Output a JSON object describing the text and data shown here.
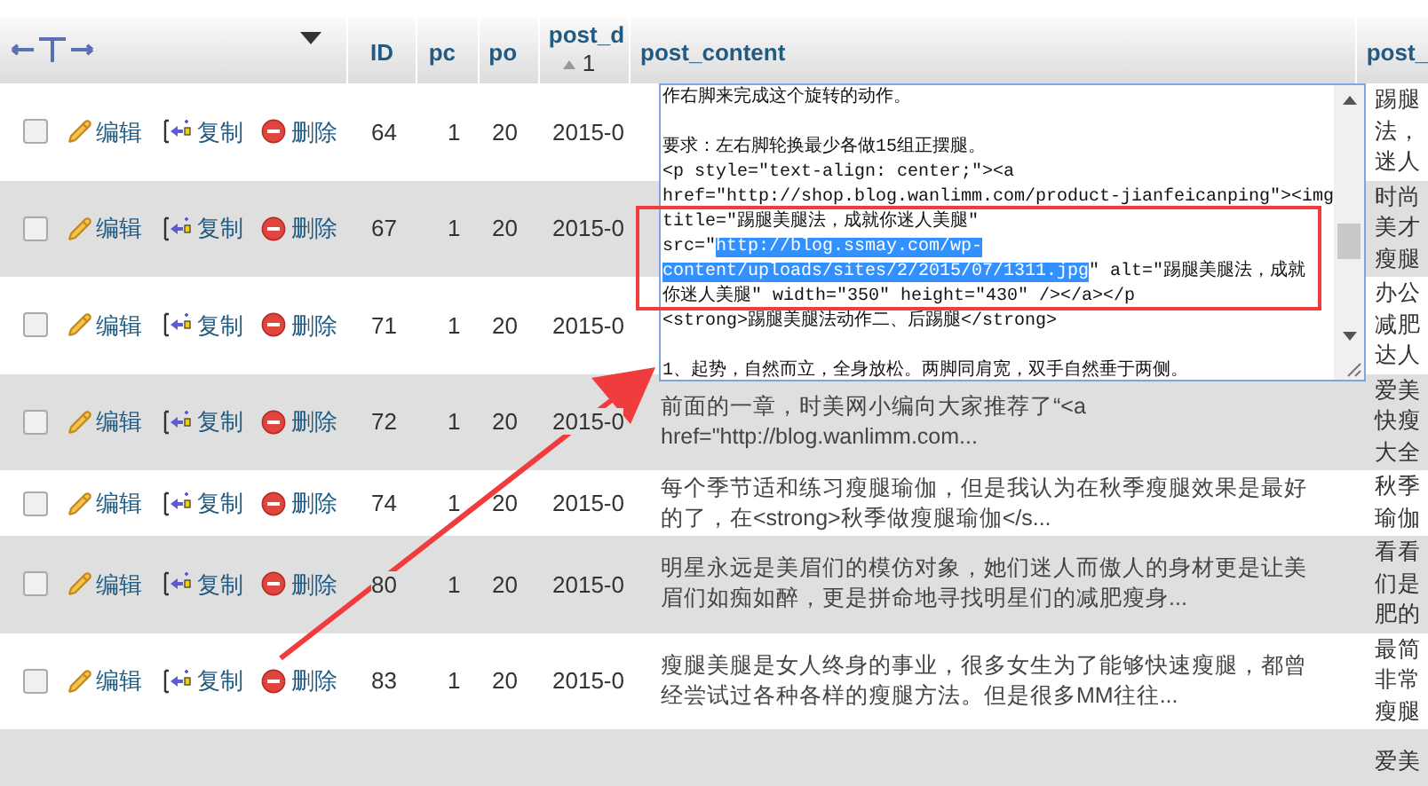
{
  "columns": [
    {
      "label": "ID"
    },
    {
      "label": "pc"
    },
    {
      "label": "po"
    },
    {
      "label": "post_d",
      "sort": "1"
    },
    {
      "label": "post_content"
    },
    {
      "label": "post_"
    }
  ],
  "rows": [
    {
      "checked": false,
      "edit": "编辑",
      "copy": "复制",
      "delete": "删除",
      "id": "64",
      "pc": "1",
      "po": "20",
      "post_date": "2015-0",
      "post_content": [],
      "post_title": [
        "踢腿",
        "法，",
        "迷人"
      ]
    },
    {
      "checked": false,
      "edit": "编辑",
      "copy": "复制",
      "delete": "删除",
      "id": "67",
      "pc": "1",
      "po": "20",
      "post_date": "2015-0",
      "post_content": [],
      "post_title": [
        "时尚",
        "美才",
        "瘦腿"
      ]
    },
    {
      "checked": false,
      "edit": "编辑",
      "copy": "复制",
      "delete": "删除",
      "id": "71",
      "pc": "1",
      "po": "20",
      "post_date": "2015-0",
      "post_content": [],
      "post_title": [
        "办公",
        "减肥",
        "达人"
      ]
    },
    {
      "checked": false,
      "edit": "编辑",
      "copy": "复制",
      "delete": "删除",
      "id": "72",
      "pc": "1",
      "po": "20",
      "post_date": "2015-0",
      "post_content": [
        "前面的一章，时美网小编向大家推荐了“<a",
        "href=\"http://blog.wanlimm.com..."
      ],
      "post_title": [
        "爱美",
        "快瘦",
        "大全"
      ]
    },
    {
      "checked": false,
      "edit": "编辑",
      "copy": "复制",
      "delete": "删除",
      "id": "74",
      "pc": "1",
      "po": "20",
      "post_date": "2015-0",
      "post_content": [
        "每个季节适和练习瘦腿瑜伽，但是我认为在秋季瘦腿效果是最好",
        "的了，在<strong>秋季做瘦腿瑜伽</s..."
      ],
      "post_title": [
        "秋季",
        "瑜伽"
      ]
    },
    {
      "checked": false,
      "edit": "编辑",
      "copy": "复制",
      "delete": "删除",
      "id": "80",
      "pc": "1",
      "po": "20",
      "post_date": "2015-0",
      "post_content": [
        "明星永远是美眉们的模仿对象，她们迷人而傲人的身材更是让美",
        "眉们如痴如醉，更是拼命地寻找明星们的减肥瘦身..."
      ],
      "post_title": [
        "看看",
        "们是",
        "肥的"
      ]
    },
    {
      "checked": false,
      "edit": "编辑",
      "copy": "复制",
      "delete": "删除",
      "id": "83",
      "pc": "1",
      "po": "20",
      "post_date": "2015-0",
      "post_content": [
        "瘦腿美腿是女人终身的事业，很多女生为了能够快速瘦腿，都曾",
        "经尝试过各种各样的瘦腿方法。但是很多MM往往..."
      ],
      "post_title": [
        "最简",
        "非常",
        "瘦腿"
      ]
    },
    {
      "post_content": [],
      "post_title": [
        "爱美"
      ]
    }
  ],
  "editor": {
    "lines": [
      {
        "kind": "text",
        "segments": [
          {
            "text": "作右脚来完成这个旋转的动作。",
            "selected": false
          }
        ]
      },
      {
        "kind": "blank"
      },
      {
        "kind": "text",
        "segments": [
          {
            "text": "要求：左右脚轮换最少各做15组正摆腿。",
            "selected": false
          }
        ]
      },
      {
        "kind": "text",
        "segments": [
          {
            "text": "<p style=\"text-align: center;\"><a",
            "selected": false
          }
        ]
      },
      {
        "kind": "text",
        "segments": [
          {
            "text": "href=\"http://shop.blog.wanlimm.com/product-jianfeicanping\"><img",
            "selected": false
          }
        ]
      },
      {
        "kind": "text",
        "segments": [
          {
            "text": "title=\"踢腿美腿法，成就你迷人美腿\"",
            "selected": false
          }
        ]
      },
      {
        "kind": "text",
        "segments": [
          {
            "text": "src=\"",
            "selected": false
          },
          {
            "text": "http://blog.ssmay.com/wp-",
            "selected": true
          }
        ]
      },
      {
        "kind": "text",
        "segments": [
          {
            "text": "content/uploads/sites/2/2015/07/1311.jpg",
            "selected": true
          },
          {
            "text": "\" alt=\"踢腿美腿法，成就",
            "selected": false
          }
        ]
      },
      {
        "kind": "text",
        "segments": [
          {
            "text": "你迷人美腿\" width=\"350\" height=\"430\" /></a></p",
            "selected": false
          }
        ]
      },
      {
        "kind": "text",
        "segments": [
          {
            "text": "<strong>踢腿美腿法动作二、后踢腿</strong>",
            "selected": false
          }
        ]
      },
      {
        "kind": "blank"
      },
      {
        "kind": "text",
        "segments": [
          {
            "text": "1、起势，自然而立，全身放松。两脚同肩宽，双手自然垂于两侧。",
            "selected": false
          }
        ]
      }
    ]
  }
}
